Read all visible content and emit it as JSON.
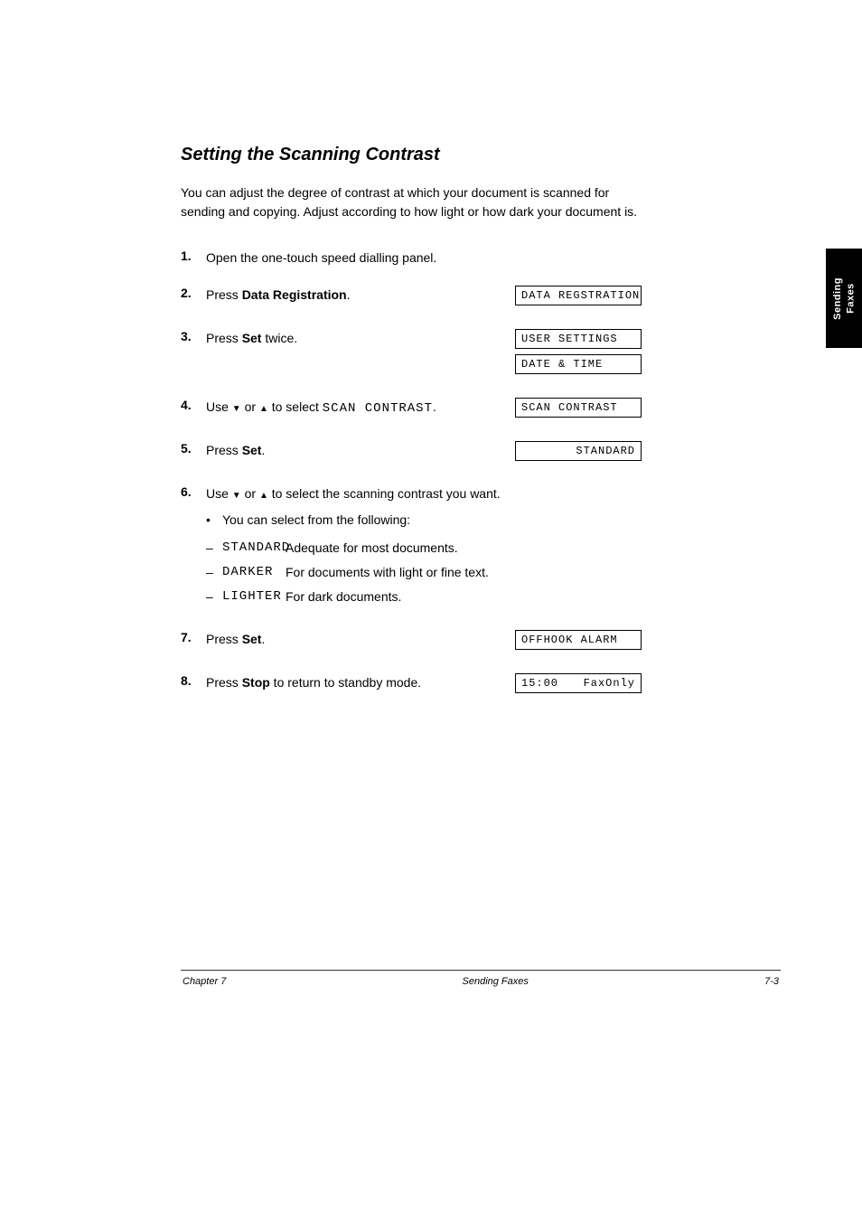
{
  "side_tab": {
    "line1": "Sending",
    "line2": "Faxes"
  },
  "section": {
    "title": "Setting the Scanning Contrast",
    "intro": "You can adjust the degree of contrast at which your document is scanned for sending and copying. Adjust according to how light or how dark your document is."
  },
  "steps": {
    "s1": {
      "num": "1.",
      "text": "Open the one-touch speed dialling panel."
    },
    "s2": {
      "num": "2.",
      "text_a": "Press ",
      "btn": "Data Registration",
      "text_b": "."
    },
    "s3": {
      "num": "3.",
      "text_a": "Press ",
      "btn": "Set",
      "text_b": " twice."
    },
    "s4": {
      "num": "4.",
      "text_a": "Use ",
      "text_b": " or ",
      "text_c": " to select ",
      "mono": "SCAN CONTRAST",
      "text_d": "."
    },
    "s5": {
      "num": "5.",
      "text_a": "Press ",
      "btn": "Set",
      "text_b": "."
    },
    "s6": {
      "num": "6.",
      "text_a": "Use ",
      "text_b": " or ",
      "text_c": " to select the scanning contrast you want.",
      "bullet_prefix": "You can select from the following:",
      "opt1_label": "STANDARD",
      "opt1_desc": "Adequate for most documents.",
      "opt2_label": "DARKER",
      "opt2_desc": "For documents with light or fine text.",
      "opt3_label": "LIGHTER",
      "opt3_desc": "For dark documents."
    },
    "s7": {
      "num": "7.",
      "text_a": "Press ",
      "btn": "Set",
      "text_b": "."
    },
    "s8": {
      "num": "8.",
      "text_a": "Press ",
      "btn": "Stop",
      "text_b": " to return to standby mode."
    }
  },
  "displays": {
    "d1": "DATA REGSTRATION",
    "d2": "USER SETTINGS",
    "d3": "DATE & TIME",
    "d4": "SCAN CONTRAST",
    "d5": "STANDARD",
    "d6": "OFFHOOK ALARM",
    "d7_left": "15:00",
    "d7_right": "FaxOnly"
  },
  "footer": {
    "left": "Chapter 7",
    "center": "Sending Faxes",
    "right": "7-3"
  }
}
